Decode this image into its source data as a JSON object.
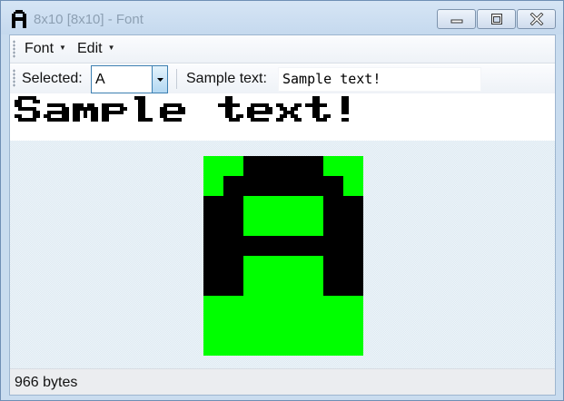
{
  "window": {
    "title": "8x10 [8x10] - Font",
    "icon": "letter-a-app-icon",
    "controls": [
      "minimize-icon",
      "maximize-icon",
      "close-icon"
    ]
  },
  "menu": {
    "items": [
      {
        "label": "Font"
      },
      {
        "label": "Edit"
      }
    ]
  },
  "toolbar": {
    "selected_label": "Selected:",
    "selected_value": "A",
    "sample_label": "Sample text:",
    "sample_value": "Sample text!"
  },
  "preview": {
    "text": "Sample text!"
  },
  "glyph": {
    "char": "A",
    "width": 8,
    "height": 10,
    "rows": [
      "00111100",
      "01111110",
      "11000011",
      "11000011",
      "11111111",
      "11000011",
      "11000011",
      "00000000",
      "00000000",
      "00000000"
    ]
  },
  "status": {
    "text": "966 bytes"
  },
  "colors": {
    "pixel_on": "#000000",
    "pixel_off": "#00ff00",
    "canvas_bg": "#dce9f2",
    "accent": "#3c7fb1"
  }
}
